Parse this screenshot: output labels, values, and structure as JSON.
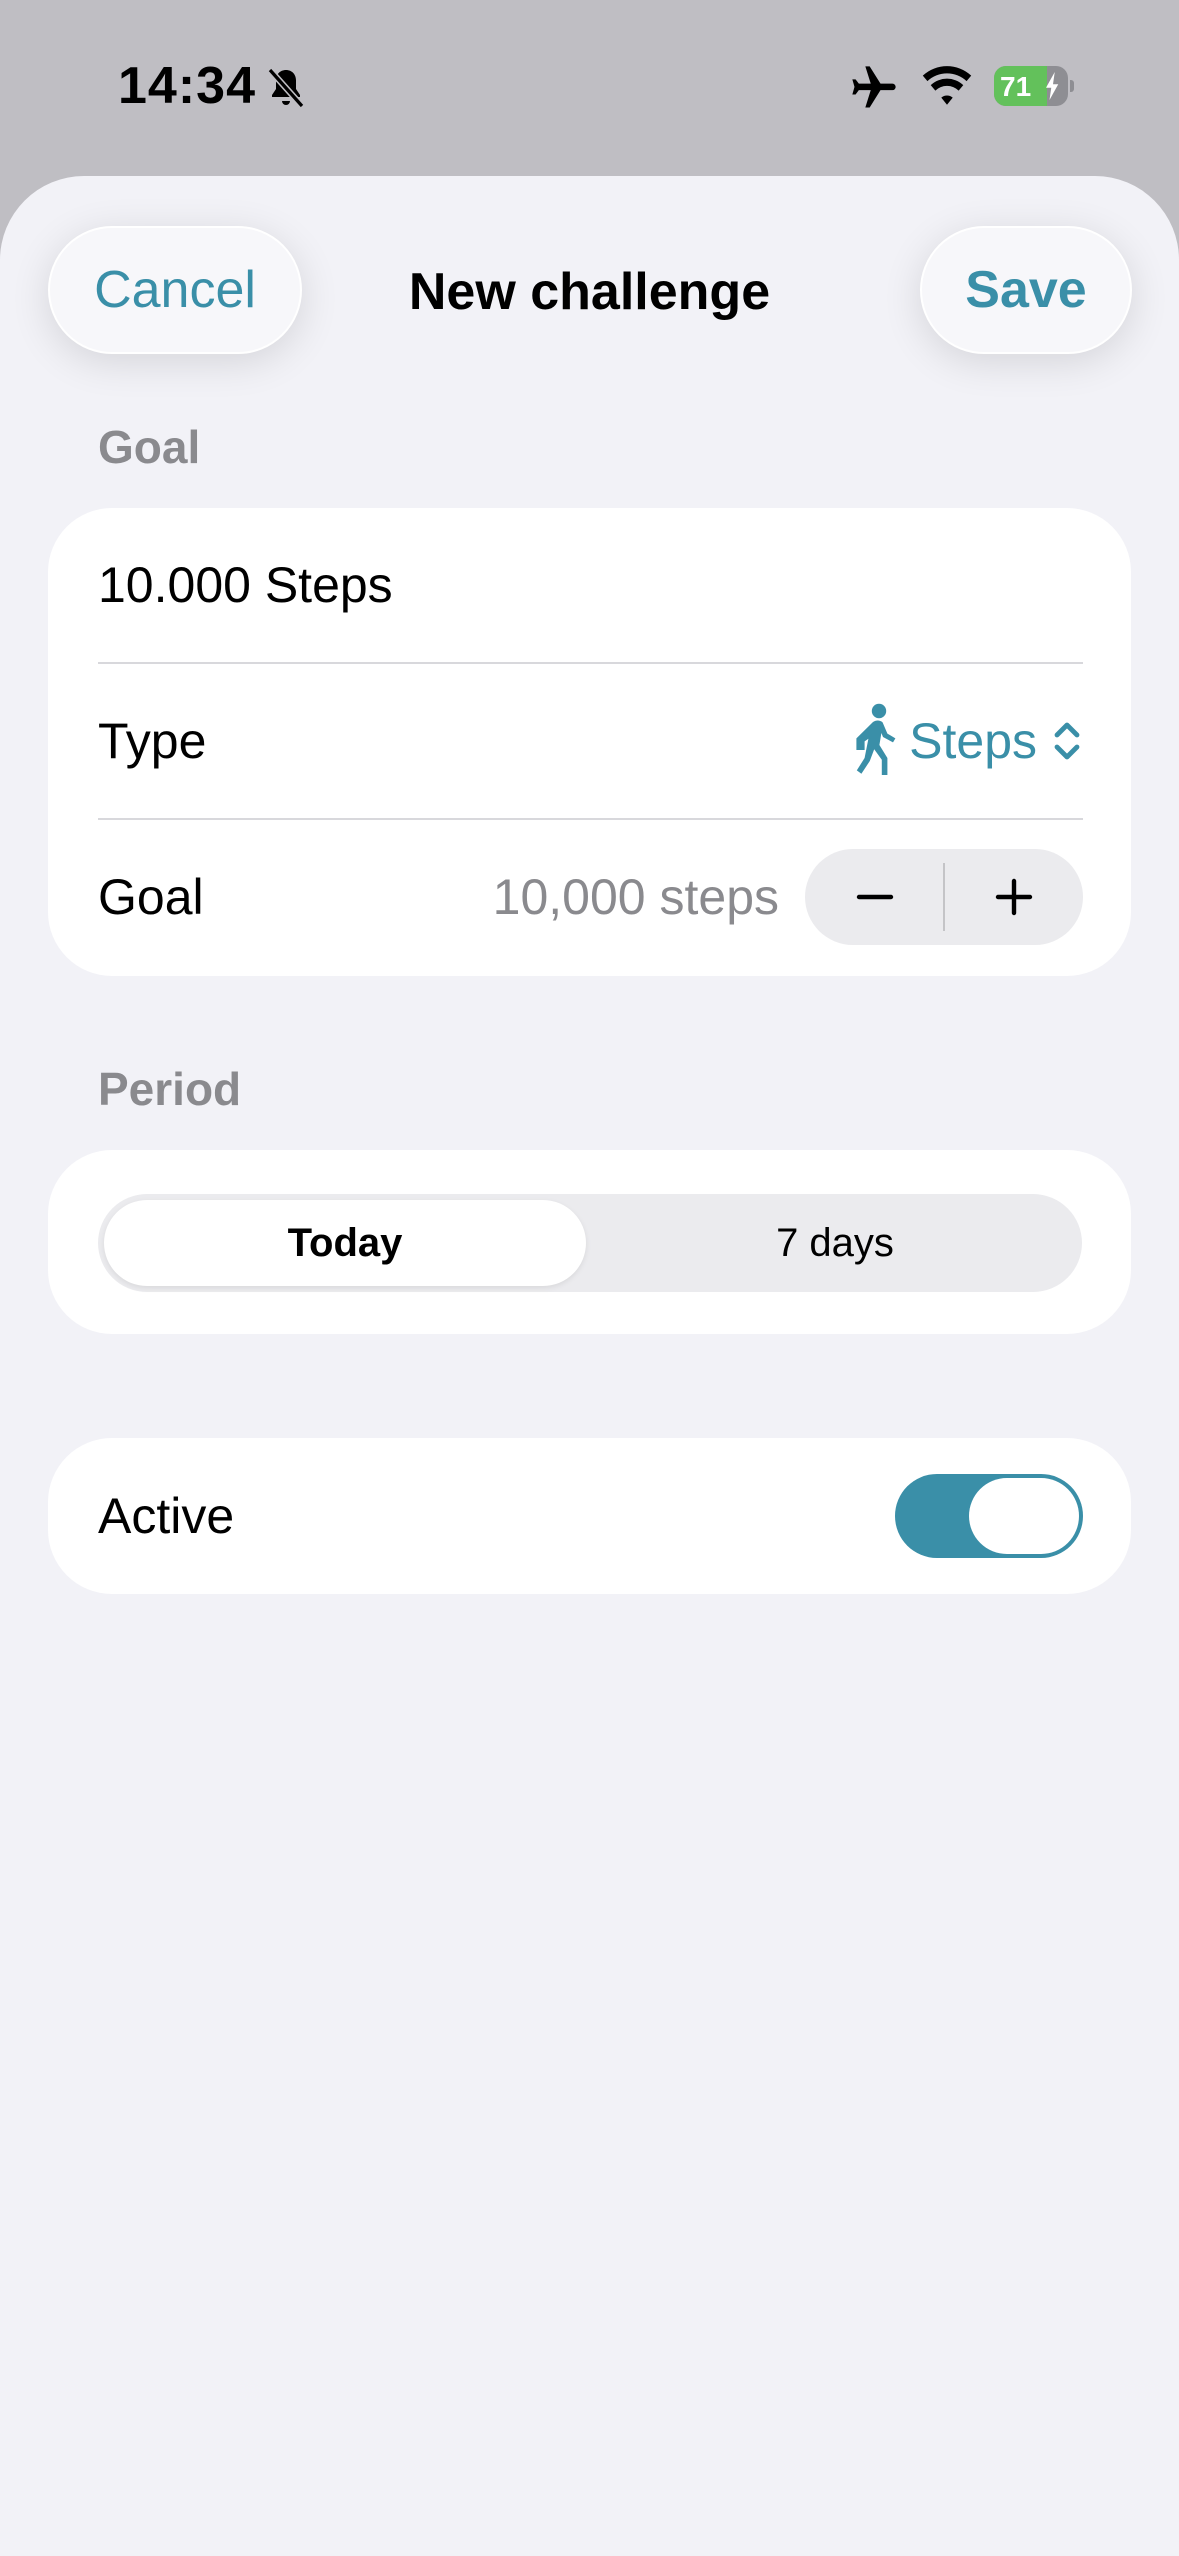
{
  "status_bar": {
    "time": "14:34",
    "battery_level": "71",
    "icons": [
      "bell-slash-icon",
      "airplane-icon",
      "wifi-icon",
      "battery-icon"
    ]
  },
  "nav": {
    "cancel_label": "Cancel",
    "title": "New challenge",
    "save_label": "Save"
  },
  "goal_section": {
    "header": "Goal",
    "name_value": "10.000 Steps",
    "type_label": "Type",
    "type_value": "Steps",
    "type_icon": "figure-walk-icon",
    "goal_label": "Goal",
    "goal_value": "10,000 steps",
    "stepper_minus": "minus-icon",
    "stepper_plus": "plus-icon"
  },
  "period_section": {
    "header": "Period",
    "options": [
      "Today",
      "7 days"
    ],
    "selected": "Today"
  },
  "active_section": {
    "label": "Active",
    "toggle_on": true
  },
  "colors": {
    "accent": "#3a8fa8",
    "background": "#f2f2f7",
    "card": "#ffffff",
    "secondary_text": "#8a8a8e",
    "battery_green": "#63c15b"
  }
}
